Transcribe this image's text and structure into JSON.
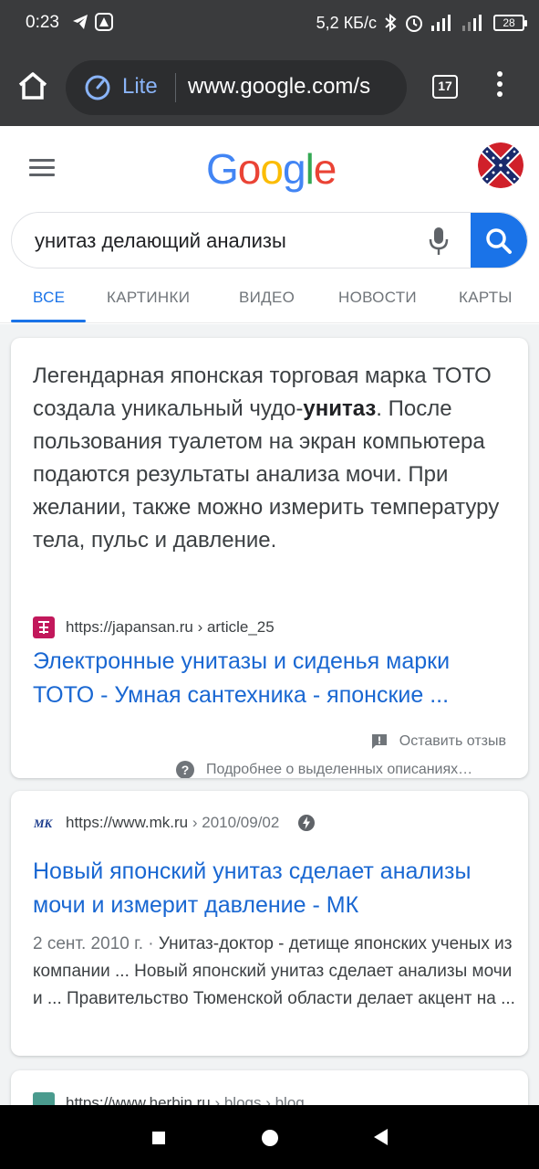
{
  "status_bar": {
    "time": "0:23",
    "net_speed": "5,2 КБ/с",
    "battery": "28"
  },
  "browser": {
    "lite_label": "Lite",
    "url": "www.google.com/s",
    "tab_count": "17"
  },
  "google": {
    "logo_letters": [
      {
        "ch": "G",
        "color": "#4285F4"
      },
      {
        "ch": "o",
        "color": "#EA4335"
      },
      {
        "ch": "o",
        "color": "#FBBC05"
      },
      {
        "ch": "g",
        "color": "#4285F4"
      },
      {
        "ch": "l",
        "color": "#34A853"
      },
      {
        "ch": "e",
        "color": "#EA4335"
      }
    ]
  },
  "search": {
    "query": "унитаз делающий анализы"
  },
  "tabs": [
    {
      "label": "ВСЕ",
      "active": true
    },
    {
      "label": "КАРТИНКИ",
      "active": false
    },
    {
      "label": "ВИДЕО",
      "active": false
    },
    {
      "label": "НОВОСТИ",
      "active": false
    },
    {
      "label": "КАРТЫ",
      "active": false
    }
  ],
  "featured_snippet": {
    "text_before": "Легендарная японская торговая марка ТОТО создала уникальный чудо-",
    "text_bold": "унитаз",
    "text_after": ". После пользования туалетом на экран компьютера подаются результаты анализа мочи. При желании, также можно измерить температуру тела, пульс и давление.",
    "source_domain": "https://japansan.ru",
    "source_path": " › article_25",
    "title": "Электронные унитазы и сиденья марки ТОТО - Умная сантехника - японские ...",
    "feedback_label": "Оставить отзыв",
    "about_label": "Подробнее о выделенных описаниях…"
  },
  "results": [
    {
      "source_domain": "https://www.mk.ru",
      "source_path": " › 2010/09/02",
      "title": "Новый японский унитаз сделает анализы мочи и измерит давление - МК",
      "date": "2 сент. 2010 г. · ",
      "snippet": "Унитаз-доктор - детище японских ученых из компании ... Новый японский унитаз сделает анализы мочи и ... Правительство Тюменской области делает акцент на ..."
    },
    {
      "source_domain": "https://www.herbin.ru",
      "source_path": " › blogs › blog"
    }
  ],
  "colors": {
    "accent": "#1a73e8",
    "link": "#1967d2",
    "chrome_dark": "#3a3b3d"
  }
}
